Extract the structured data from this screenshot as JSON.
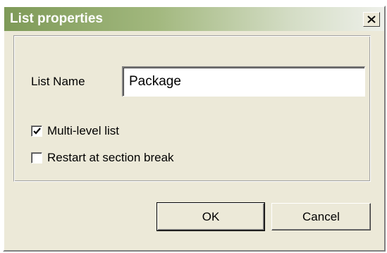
{
  "dialog": {
    "title": "List properties",
    "list_name_label": "List Name",
    "list_name_value": "Package",
    "multilevel_label": "Multi-level list",
    "multilevel_checked": true,
    "restart_label": "Restart at section break",
    "restart_checked": false,
    "ok_label": "OK",
    "cancel_label": "Cancel",
    "close_icon": "close-icon",
    "check_icon": "checkmark-icon"
  }
}
